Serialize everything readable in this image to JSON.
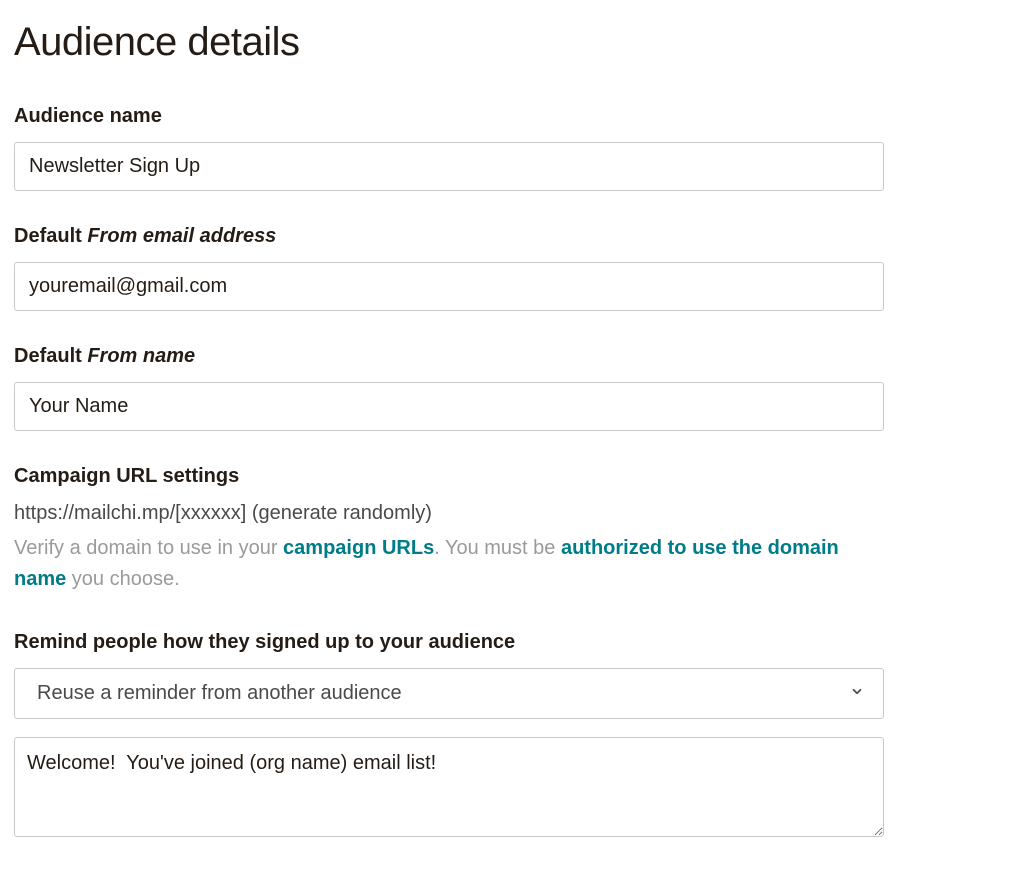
{
  "page": {
    "title": "Audience details"
  },
  "audienceName": {
    "label": "Audience name",
    "value": "Newsletter Sign Up"
  },
  "fromEmail": {
    "label_prefix": "Default ",
    "label_italic": "From email address",
    "value": "youremail@gmail.com"
  },
  "fromName": {
    "label_prefix": "Default ",
    "label_italic": "From name",
    "value": "Your Name"
  },
  "campaignUrl": {
    "header": "Campaign URL settings",
    "urlLine": "https://mailchi.mp/[xxxxxx] (generate randomly)",
    "help_part1": "Verify a domain to use in your ",
    "help_link1": "campaign URLs",
    "help_part2": ". You must be ",
    "help_link2": "authorized to use the domain name",
    "help_part3": " you choose."
  },
  "reminder": {
    "header": "Remind people how they signed up to your audience",
    "selectLabel": "Reuse a reminder from another audience",
    "textValue": "Welcome!  You've joined (org name) email list!"
  }
}
